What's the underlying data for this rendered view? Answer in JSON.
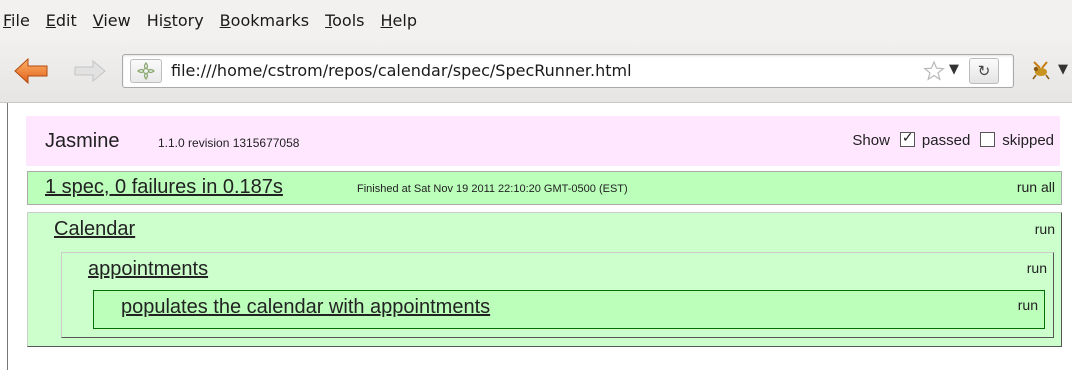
{
  "menu": {
    "items": [
      {
        "label": "File",
        "mnemonic_index": 0
      },
      {
        "label": "Edit",
        "mnemonic_index": 0
      },
      {
        "label": "View",
        "mnemonic_index": 0
      },
      {
        "label": "History",
        "mnemonic_index": 2
      },
      {
        "label": "Bookmarks",
        "mnemonic_index": 0
      },
      {
        "label": "Tools",
        "mnemonic_index": 0
      },
      {
        "label": "Help",
        "mnemonic_index": 0
      }
    ]
  },
  "nav": {
    "url": "file:///home/cstrom/repos/calendar/spec/SpecRunner.html",
    "icons": [
      "back-arrow-icon",
      "forward-arrow-icon",
      "site-identity-icon",
      "bookmark-star-icon",
      "dropdown-arrow-icon",
      "reload-icon",
      "extension-icon"
    ]
  },
  "jasmine": {
    "logo": "Jasmine",
    "version": "1.1.0 revision 1315677058",
    "show_label": "Show",
    "passed_label": "passed",
    "passed_checked": true,
    "skipped_label": "skipped",
    "skipped_checked": false
  },
  "runner": {
    "summary": "1 spec, 0 failures in 0.187s",
    "finished": "Finished at Sat Nov 19 2011 22:10:20 GMT-0500 (EST)",
    "run_all_label": "run all"
  },
  "suites": {
    "calendar": {
      "title": "Calendar",
      "run_label": "run"
    },
    "appointments": {
      "title": "appointments",
      "run_label": "run"
    },
    "spec": {
      "title": "populates the calendar with appointments",
      "run_label": "run"
    }
  },
  "colors": {
    "banner_bg": "#ffe7ff",
    "passed_bg": "#bbffbb",
    "suite_bg": "#ccffcc",
    "spec_border": "#007000"
  }
}
